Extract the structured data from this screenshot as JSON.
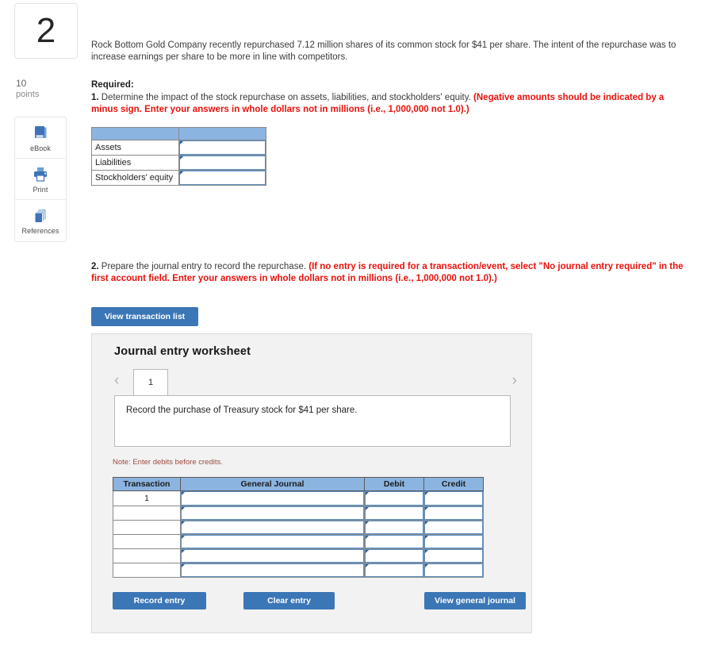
{
  "question": {
    "number": "2",
    "points_value": "10",
    "points_label": "points"
  },
  "tools": [
    {
      "icon": "ebook-icon",
      "label": "eBook"
    },
    {
      "icon": "print-icon",
      "label": "Print"
    },
    {
      "icon": "references-icon",
      "label": "References"
    }
  ],
  "stem": {
    "text": "Rock Bottom Gold Company recently repurchased 7.12 million shares of its common stock for $41 per share. The intent of the repurchase was to increase earnings per share to be more in line with competitors."
  },
  "requirement": {
    "heading": "Required:",
    "item1_number": "1.",
    "item1_text": " Determine the impact of the stock repurchase on assets, liabilities, and stockholders' equity. ",
    "item1_red": "(Negative amounts should be indicated by a minus sign. Enter your answers in whole dollars not in millions (i.e., 1,000,000 not 1.0).)",
    "item2_number": "2.",
    "item2_text": " Prepare the journal entry to record the repurchase. ",
    "item2_red": "(If no entry is required for a transaction/event, select \"No journal entry required\" in the first account field. Enter your answers in whole dollars not in millions (i.e., 1,000,000 not 1.0).)"
  },
  "impact_table": {
    "header": [
      "",
      ""
    ],
    "rows": [
      {
        "label": "Assets",
        "value": ""
      },
      {
        "label": "Liabilities",
        "value": ""
      },
      {
        "label": "Stockholders' equity",
        "value": ""
      }
    ]
  },
  "view_transaction_list_label": "View transaction list",
  "worksheet": {
    "title": "Journal entry worksheet",
    "prev_icon": "chevron-left-icon",
    "next_icon": "chevron-right-icon",
    "tabs": [
      {
        "label": "1",
        "selected": true
      }
    ],
    "instruction": "Record the purchase of Treasury stock for $41 per share.",
    "note": "Note: Enter debits before credits.",
    "table": {
      "columns": [
        "Transaction",
        "General Journal",
        "Debit",
        "Credit"
      ],
      "rows": [
        {
          "transaction": "1",
          "general_journal": "",
          "debit": "",
          "credit": ""
        },
        {
          "transaction": "",
          "general_journal": "",
          "debit": "",
          "credit": ""
        },
        {
          "transaction": "",
          "general_journal": "",
          "debit": "",
          "credit": ""
        },
        {
          "transaction": "",
          "general_journal": "",
          "debit": "",
          "credit": ""
        },
        {
          "transaction": "",
          "general_journal": "",
          "debit": "",
          "credit": ""
        },
        {
          "transaction": "",
          "general_journal": "",
          "debit": "",
          "credit": ""
        }
      ]
    },
    "buttons": {
      "record": "Record entry",
      "clear": "Clear entry",
      "view_general_journal": "View general journal"
    }
  },
  "colors": {
    "table_header_blue": "#8bb4e0",
    "button_blue": "#3b76b6",
    "instruction_red": "#e8120c",
    "note_red": "#9a4a3e",
    "panel_gray": "#f2f2f2",
    "icon_blue": "#3f72b8"
  }
}
